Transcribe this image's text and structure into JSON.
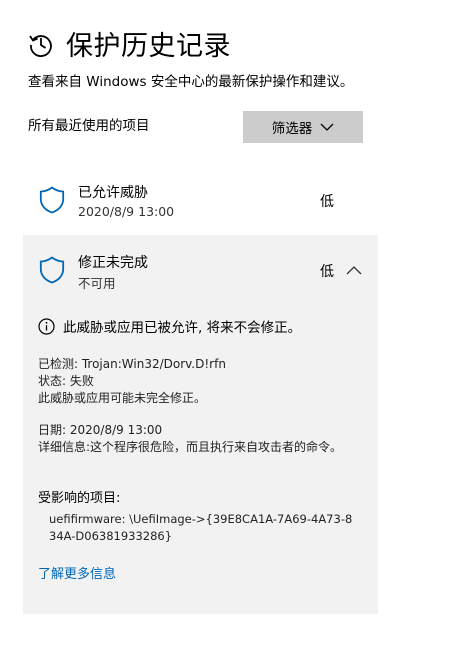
{
  "header": {
    "title": "保护历史记录",
    "subtitle": "查看来自 Windows 安全中心的最新保护操作和建议。"
  },
  "list": {
    "section_label": "所有最近使用的项目",
    "filter_label": "筛选器"
  },
  "items": [
    {
      "title": "已允许威胁",
      "date": "2020/8/9 13:00",
      "severity": "低"
    },
    {
      "title": "修正未完成",
      "subtitle": "不可用",
      "severity": "低",
      "info": "此威胁或应用已被允许, 将来不会修正。",
      "detected": "已检测: Trojan:Win32/Dorv.D!rfn",
      "status": "状态: 失败",
      "warning": "此威胁或应用可能未完全修正。",
      "date": "日期: 2020/8/9 13:00",
      "details_label": "详细信息: ",
      "details_value": "这个程序很危险，而且执行来自攻击者的命令。",
      "affected_title": "受影响的项目:",
      "affected_path": "uefifirmware: \\UefiImage->{39E8CA1A-7A69-4A73-834A-D06381933286}",
      "learn_more": "了解更多信息"
    }
  ],
  "colors": {
    "shield": "#0067b8",
    "link": "#0067b8",
    "expanded_bg": "#f2f2f2",
    "filter_bg": "#cccccc"
  },
  "icons": {
    "header": "history-icon",
    "filter": "chevron-down-icon",
    "item": "shield-icon",
    "collapse": "chevron-up-icon",
    "info": "info-icon"
  }
}
